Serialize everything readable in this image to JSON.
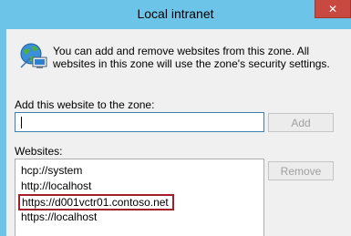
{
  "window": {
    "title": "Local intranet",
    "close_label": "✕"
  },
  "intro_text": "You can add and remove websites from this zone. All websites in this zone will use the zone's security settings.",
  "add": {
    "label": "Add this website to the zone:",
    "input_value": "",
    "button_label": "Add"
  },
  "websites": {
    "label": "Websites:",
    "items": [
      "hcp://system",
      "http://localhost",
      "https://d001vctr01.contoso.net",
      "https://localhost"
    ],
    "highlighted_index": 2,
    "remove_label": "Remove"
  },
  "colors": {
    "frame": "#6cc4e8",
    "client": "#f0f0f0",
    "close_button": "#c7493f",
    "highlight": "#a11e2a"
  },
  "icons": {
    "zone": "globe-computer-icon",
    "close": "close-icon"
  }
}
